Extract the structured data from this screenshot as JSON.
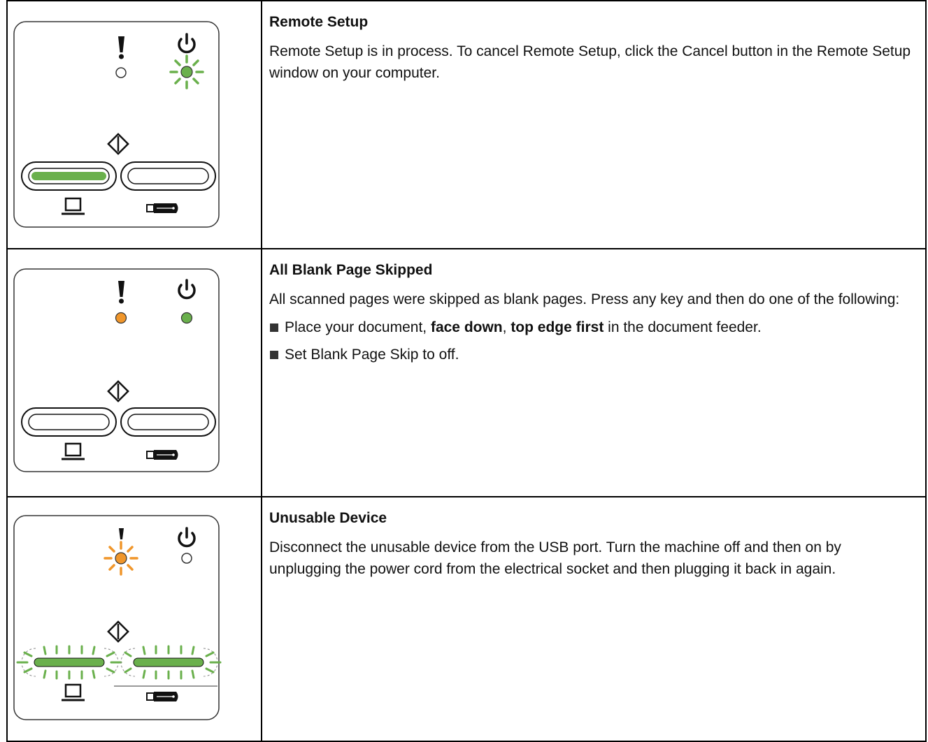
{
  "colors": {
    "green": "#6ab04c",
    "orange": "#f0962b",
    "border": "#000000"
  },
  "rows": [
    {
      "title": "Remote Setup",
      "body": "Remote Setup is in process. To cancel Remote Setup, click the Cancel button in the Remote Setup window on your computer.",
      "panel": {
        "error_led": "off",
        "power_led": "blinking-green",
        "pc_button": "lit-green",
        "usb_button": "off"
      }
    },
    {
      "title": "All Blank Page Skipped",
      "body": "All scanned pages were skipped as blank pages. Press any key and then do one of the following:",
      "bullets": [
        {
          "before": "Place your document, ",
          "bold1": "face down",
          "mid": ", ",
          "bold2": "top edge first",
          "after": " in the document feeder."
        },
        {
          "text": "Set Blank Page Skip to off."
        }
      ],
      "panel": {
        "error_led": "on-orange",
        "power_led": "on-green",
        "pc_button": "off",
        "usb_button": "off"
      }
    },
    {
      "title": "Unusable Device",
      "body": "Disconnect the unusable device from the USB port. Turn the machine off and then on by unplugging the power cord from the electrical socket and then plugging it back in again.",
      "panel": {
        "error_led": "blinking-orange",
        "power_led": "off",
        "pc_button": "blinking-green",
        "usb_button": "blinking-green"
      }
    }
  ],
  "icons": [
    "error-exclamation-icon",
    "power-icon",
    "start-diamond-icon",
    "computer-icon",
    "usb-icon"
  ]
}
